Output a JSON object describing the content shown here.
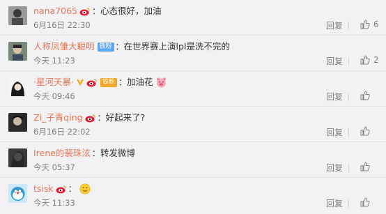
{
  "comments": [
    {
      "username": "nana7065",
      "badges": [
        "weibo-red-icon"
      ],
      "fan_badge": "",
      "text": "心态很好，加油",
      "emoji": "",
      "time": "6月16日 22:30",
      "reply_label": "回复",
      "likes": "6"
    },
    {
      "username": "人称凤雏大聪明",
      "badges": [],
      "fan_badge": "铁粉",
      "text": "在世界赛上演lpl是洗不完的",
      "emoji": "",
      "time": "今天 11:23",
      "reply_label": "回复",
      "likes": "2"
    },
    {
      "username": "·星河天暴·",
      "badges": [
        "verified-v-icon",
        "weibo-red-icon"
      ],
      "fan_badge": "铁粉",
      "text": "加油花",
      "emoji": "pig-face-emoji",
      "time": "今天 09:46",
      "reply_label": "回复",
      "likes": ""
    },
    {
      "username": "Zi_子青qing",
      "badges": [
        "weibo-red-icon"
      ],
      "fan_badge": "",
      "text": "好起来了?",
      "emoji": "",
      "time": "6月16日 22:02",
      "reply_label": "回复",
      "likes": ""
    },
    {
      "username": "Irene的裴珠泫",
      "badges": [],
      "fan_badge": "",
      "text": "转发微博",
      "emoji": "",
      "time": "今天 05:37",
      "reply_label": "回复",
      "likes": ""
    },
    {
      "username": "tsisk",
      "badges": [
        "weibo-red-icon"
      ],
      "fan_badge": "",
      "text": "",
      "emoji": "smile-emoji",
      "time": "今天 11:33",
      "reply_label": "回复",
      "likes": ""
    }
  ],
  "colors": {
    "username": "#eb7350",
    "text": "#333333",
    "meta": "#808080",
    "background": "#f2f2f5"
  }
}
